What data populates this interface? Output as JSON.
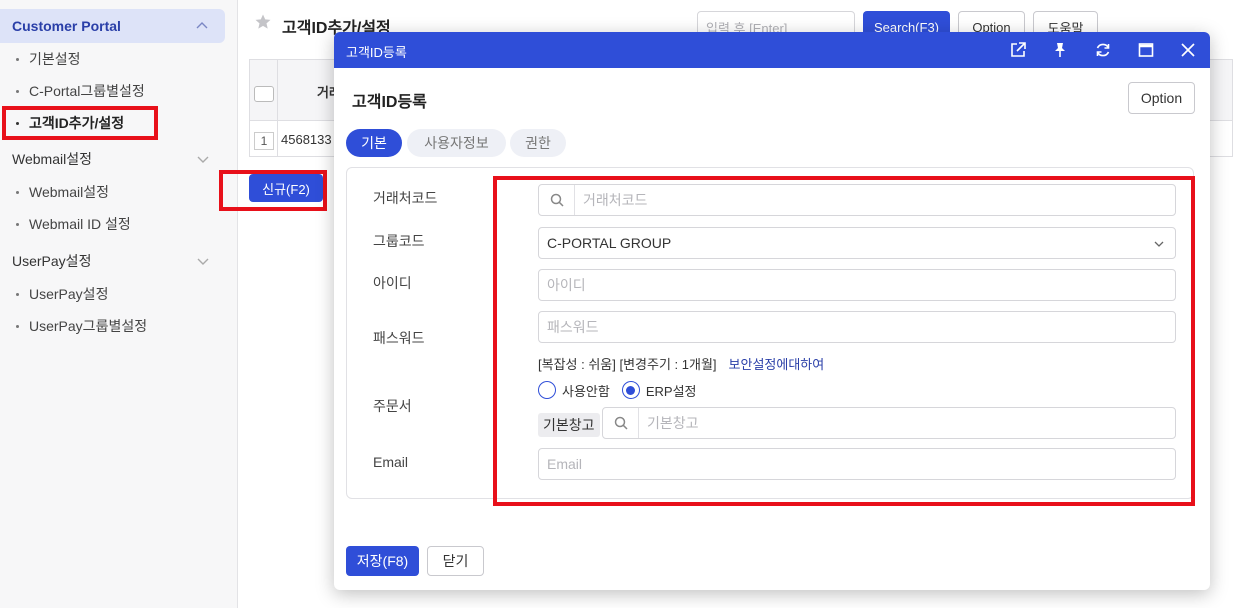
{
  "sidebar": {
    "groups": [
      {
        "label": "Customer Portal",
        "items": [
          "기본설정",
          "C-Portal그룹별설정",
          "고객ID추가/설정"
        ]
      },
      {
        "label": "Webmail설정",
        "items": [
          "Webmail설정",
          "Webmail ID 설정"
        ]
      },
      {
        "label": "UserPay설정",
        "items": [
          "UserPay설정",
          "UserPay그룹별설정"
        ]
      }
    ]
  },
  "page": {
    "title": "고객ID추가/설정",
    "search_placeholder": "입력 후 [Enter]",
    "search_button": "Search(F3)",
    "option_button": "Option",
    "help_button": "도움말",
    "table": {
      "column_head": "거래",
      "row_number": "1",
      "row_value": "4568133"
    },
    "new_button": "신규(F2)"
  },
  "modal": {
    "window_title": "고객ID등록",
    "heading": "고객ID등록",
    "option_button": "Option",
    "tabs": [
      {
        "label": "기본",
        "active": true
      },
      {
        "label": "사용자정보",
        "active": false
      },
      {
        "label": "권한",
        "active": false
      }
    ],
    "form": {
      "vendor_code": {
        "label": "거래처코드",
        "placeholder": "거래처코드"
      },
      "group_code": {
        "label": "그룹코드",
        "value": "C-PORTAL GROUP"
      },
      "user_id": {
        "label": "아이디",
        "placeholder": "아이디"
      },
      "password": {
        "label": "패스워드",
        "placeholder": "패스워드"
      },
      "password_hint": "[복잡성 : 쉬움] [변경주기 : 1개월]",
      "security_link": "보안설정에대하여",
      "order": {
        "label": "주문서",
        "radio_none": "사용안함",
        "radio_erp": "ERP설정",
        "selected": "ERP설정",
        "warehouse_chip": "기본창고",
        "warehouse_placeholder": "기본창고"
      },
      "email": {
        "label": "Email",
        "placeholder": "Email"
      }
    },
    "save_button": "저장(F8)",
    "close_button": "닫기"
  },
  "colors": {
    "primary": "#2f4ed8",
    "highlight": "#e8101a",
    "sidebar_active_bg": "#dde3f8"
  }
}
